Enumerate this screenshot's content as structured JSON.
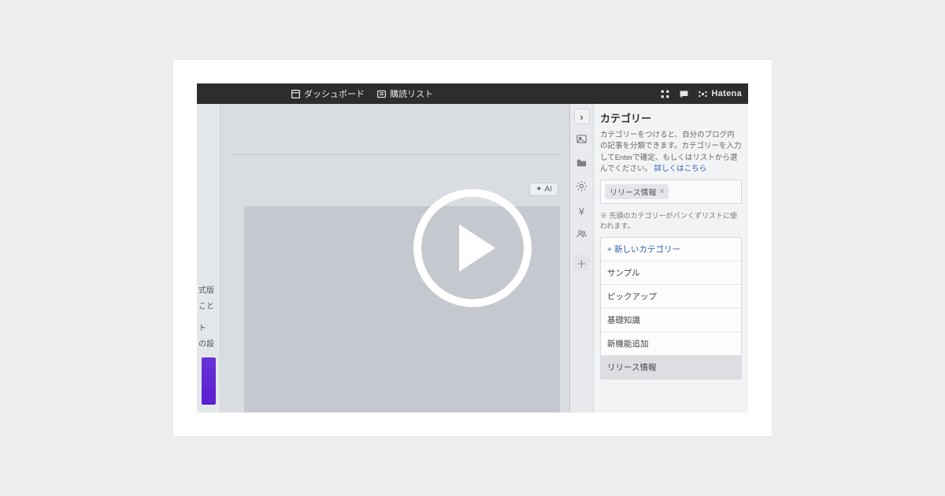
{
  "topbar": {
    "dashboard": "ダッシュボード",
    "reading_list": "購読リスト",
    "brand": "Hatena"
  },
  "left_fragments": [
    "式版",
    "こと",
    "ト",
    "の設"
  ],
  "ai_button": "AI",
  "panel": {
    "title": "カテゴリー",
    "desc_prefix": "カテゴリーをつけると、自分のブログ内の記事を分類できます。カテゴリーを入力してEnterで確定、もしくはリストから選んでください。",
    "desc_link": "詳しくはこちら",
    "chip": "リリース情報",
    "note": "※ 先頭のカテゴリーがパンくずリストに使われます。",
    "new_label": "新しいカテゴリー",
    "categories": [
      "サンプル",
      "ピックアップ",
      "基礎知識",
      "新機能追加",
      "リリース情報"
    ],
    "selected": "リリース情報"
  }
}
